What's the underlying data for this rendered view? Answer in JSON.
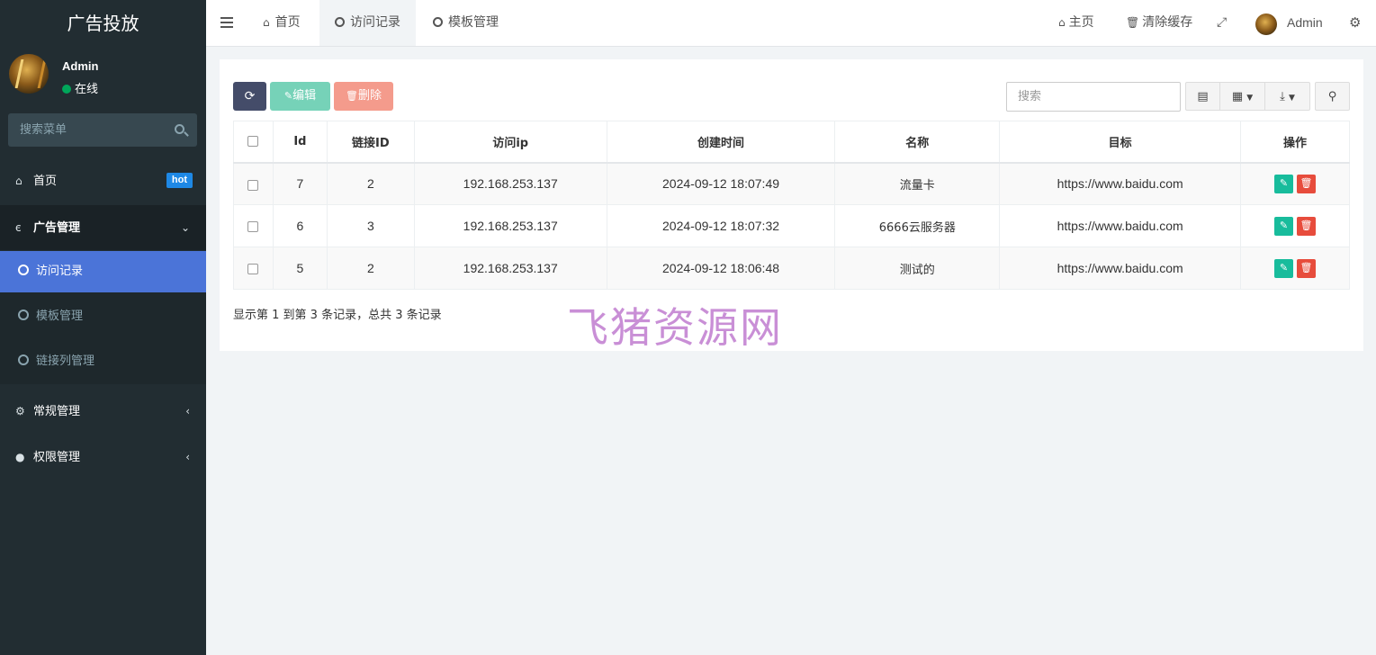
{
  "sidebar": {
    "title": "广告投放",
    "user": {
      "name": "Admin",
      "status": "在线"
    },
    "search_placeholder": "搜索菜单",
    "items": [
      {
        "label": "首页",
        "icon": "home-icon",
        "badge": "hot"
      },
      {
        "label": "广告管理",
        "icon": "internet-explorer-icon",
        "children": [
          {
            "label": "访问记录"
          },
          {
            "label": "模板管理"
          },
          {
            "label": "链接列管理"
          }
        ]
      },
      {
        "label": "常规管理",
        "icon": "cogs-icon"
      },
      {
        "label": "权限管理",
        "icon": "users-icon"
      }
    ]
  },
  "topbar": {
    "tabs": [
      {
        "label": "首页",
        "icon": "home-icon"
      },
      {
        "label": "访问记录",
        "icon": "circle-icon"
      },
      {
        "label": "模板管理",
        "icon": "circle-icon"
      }
    ],
    "right": {
      "home": "主页",
      "clear_cache": "清除缓存",
      "user": "Admin"
    }
  },
  "toolbar": {
    "edit": "编辑",
    "delete": "删除",
    "search_placeholder": "搜索"
  },
  "table": {
    "columns": [
      "Id",
      "链接ID",
      "访问ip",
      "创建时间",
      "名称",
      "目标",
      "操作"
    ],
    "rows": [
      {
        "id": "7",
        "link_id": "2",
        "ip": "192.168.253.137",
        "created": "2024-09-12 18:07:49",
        "name": "流量卡",
        "target": "https://www.baidu.com"
      },
      {
        "id": "6",
        "link_id": "3",
        "ip": "192.168.253.137",
        "created": "2024-09-12 18:07:32",
        "name": "6666云服务器",
        "target": "https://www.baidu.com"
      },
      {
        "id": "5",
        "link_id": "2",
        "ip": "192.168.253.137",
        "created": "2024-09-12 18:06:48",
        "name": "测试的",
        "target": "https://www.baidu.com"
      }
    ],
    "summary": "显示第 1 到第 3 条记录，总共 3 条记录"
  },
  "watermark": "飞猪资源网",
  "colors": {
    "sidebar_bg": "#222d32",
    "active_item": "#4b74d8",
    "edit_green": "#18bc9c",
    "delete_red": "#e74c3c"
  }
}
